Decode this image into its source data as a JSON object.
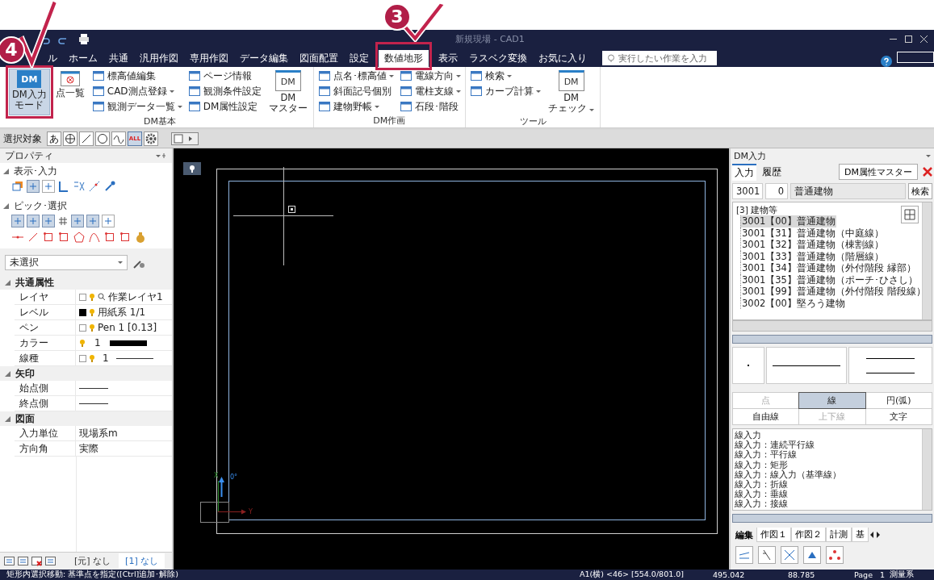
{
  "title_bar": {
    "title": "新規現場 - CAD1"
  },
  "menu_tabs": [
    {
      "label": "ル",
      "selected": false
    },
    {
      "label": "ホーム",
      "selected": false
    },
    {
      "label": "共通",
      "selected": false
    },
    {
      "label": "汎用作図",
      "selected": false
    },
    {
      "label": "専用作図",
      "selected": false
    },
    {
      "label": "データ編集",
      "selected": false
    },
    {
      "label": "図面配置",
      "selected": false
    },
    {
      "label": "設定",
      "selected": false
    },
    {
      "label": "数値地形",
      "selected": true
    },
    {
      "label": "表示",
      "selected": false
    },
    {
      "label": "ラスベク変換",
      "selected": false
    },
    {
      "label": "お気に入り",
      "selected": false
    }
  ],
  "tell_me": {
    "placeholder": "実行したい作業を入力"
  },
  "ribbon_groups": [
    {
      "label": "DM基本",
      "columns": [
        {
          "kind": "large",
          "icon_text": "DM",
          "lines": [
            "DM入力",
            "モード"
          ],
          "selected": true,
          "dropdown": false
        },
        {
          "kind": "large",
          "lines": [
            "点一覧"
          ],
          "selected": false,
          "dropdown": false
        },
        {
          "kind": "small",
          "items": [
            {
              "label": "標高値編集",
              "dropdown": false
            },
            {
              "label": "CAD測点登録",
              "dropdown": true
            },
            {
              "label": "観測データ一覧",
              "dropdown": true
            }
          ]
        },
        {
          "kind": "small",
          "items": [
            {
              "label": "ページ情報",
              "dropdown": false
            },
            {
              "label": "観測条件設定",
              "dropdown": false
            },
            {
              "label": "DM属性設定",
              "dropdown": false
            }
          ]
        },
        {
          "kind": "large",
          "icon_text": "DM",
          "lines": [
            "DM",
            "マスター"
          ],
          "selected": false,
          "dropdown": false
        }
      ]
    },
    {
      "label": "DM作画",
      "columns": [
        {
          "kind": "small",
          "items": [
            {
              "label": "点名･標高値",
              "dropdown": true
            },
            {
              "label": "斜面記号個別",
              "dropdown": false
            },
            {
              "label": "建物野帳",
              "dropdown": true
            }
          ]
        },
        {
          "kind": "small",
          "items": [
            {
              "label": "電線方向",
              "dropdown": true
            },
            {
              "label": "電柱支線",
              "dropdown": true
            },
            {
              "label": "石段･階段",
              "dropdown": false
            }
          ]
        }
      ]
    },
    {
      "label": "ツール",
      "columns": [
        {
          "kind": "small",
          "items": [
            {
              "label": "検索",
              "dropdown": true
            },
            {
              "label": "カーブ計算",
              "dropdown": true
            }
          ]
        },
        {
          "kind": "large",
          "icon_text": "DM",
          "lines": [
            "DM",
            "チェック"
          ],
          "selected": false,
          "dropdown": true
        }
      ]
    }
  ],
  "selection_toolbar": {
    "label": "選択対象",
    "text_button": "あ",
    "all_button": {
      "label": "ALL",
      "selected": true
    }
  },
  "properties_panel": {
    "title": "プロパティ",
    "sections": [
      {
        "label": "表示･入力",
        "expanded": true
      },
      {
        "label": "ピック･選択",
        "expanded": true
      }
    ],
    "selector": {
      "value": "未選択"
    },
    "categories": [
      {
        "label": "共通属性",
        "expanded": true,
        "rows": [
          {
            "label": "レイヤ",
            "kind": "layer",
            "value": "作業レイヤ1",
            "checked": false
          },
          {
            "label": "レベル",
            "kind": "level",
            "value": "用紙系 1/1"
          },
          {
            "label": "ペン",
            "kind": "pen",
            "value": "Pen 1 [0.13]",
            "checked": false
          },
          {
            "label": "カラー",
            "kind": "color",
            "value": "1"
          },
          {
            "label": "線種",
            "kind": "linetype",
            "value": "1",
            "checked": false
          }
        ]
      },
      {
        "label": "矢印",
        "expanded": true,
        "rows": [
          {
            "label": "始点側",
            "kind": "line"
          },
          {
            "label": "終点側",
            "kind": "line"
          }
        ]
      },
      {
        "label": "図面",
        "expanded": true,
        "rows": [
          {
            "label": "入力単位",
            "kind": "text",
            "value": "現場系m"
          },
          {
            "label": "方向角",
            "kind": "text",
            "value": "実際"
          }
        ]
      }
    ],
    "layer_tabs": [
      {
        "label": "[元] なし",
        "selected": false
      },
      {
        "label": "[1] なし",
        "selected": true
      }
    ]
  },
  "canvas": {
    "axis_labels": [
      "X",
      "0°",
      "Y"
    ]
  },
  "dm_panel": {
    "title": "DM入力",
    "tabs": [
      {
        "label": "入力",
        "selected": true
      },
      {
        "label": "履歴",
        "selected": false
      }
    ],
    "master_button": "DM属性マスター",
    "code": "3001",
    "sub_code": "0",
    "name": "普通建物",
    "search_button": "検索",
    "tree": {
      "label": "[3] 建物等",
      "children": [
        {
          "label": "3001【00】普通建物",
          "selected": true
        },
        {
          "label": "3001【31】普通建物（中庭線）",
          "selected": false
        },
        {
          "label": "3001【32】普通建物（棟割線）",
          "selected": false
        },
        {
          "label": "3001【33】普通建物（階層線）",
          "selected": false
        },
        {
          "label": "3001【34】普通建物（外付階段 縁部）",
          "selected": false
        },
        {
          "label": "3001【35】普通建物（ポーチ･ひさし）",
          "selected": false
        },
        {
          "label": "3001【99】普通建物（外付階段 階段線）",
          "selected": false
        },
        {
          "label": "3002【00】堅ろう建物",
          "selected": false
        }
      ]
    },
    "modes": [
      {
        "label": "点",
        "selected": false,
        "disabled": true
      },
      {
        "label": "線",
        "selected": true,
        "disabled": false
      },
      {
        "label": "円(弧)",
        "selected": false,
        "disabled": false
      },
      {
        "label": "自由線",
        "selected": false,
        "disabled": false
      },
      {
        "label": "上下線",
        "selected": false,
        "disabled": true
      },
      {
        "label": "文字",
        "selected": false,
        "disabled": false
      }
    ],
    "commands": [
      "線入力",
      "線入力：連続平行線",
      "線入力：平行線",
      "線入力：矩形",
      "線入力：線入力（基準線）",
      "線入力：折線",
      "線入力：垂線",
      "線入力：接線"
    ],
    "bottom_tabs": [
      {
        "label": "編集",
        "selected": true
      },
      {
        "label": "作図１",
        "selected": false
      },
      {
        "label": "作図２",
        "selected": false
      },
      {
        "label": "計測",
        "selected": false
      },
      {
        "label": "基",
        "selected": false
      }
    ]
  },
  "status_bar": {
    "message": "矩形内選択移動: 基準点を指定([Ctrl]追加･解除)",
    "sheet": "A1(横) <46> [554.0/801.0]",
    "reading_1": "495.042",
    "reading_2": "88.785",
    "page_label": "Page",
    "page": "1",
    "system": "測量系"
  },
  "callouts": [
    {
      "number": "3"
    },
    {
      "number": "4"
    }
  ]
}
